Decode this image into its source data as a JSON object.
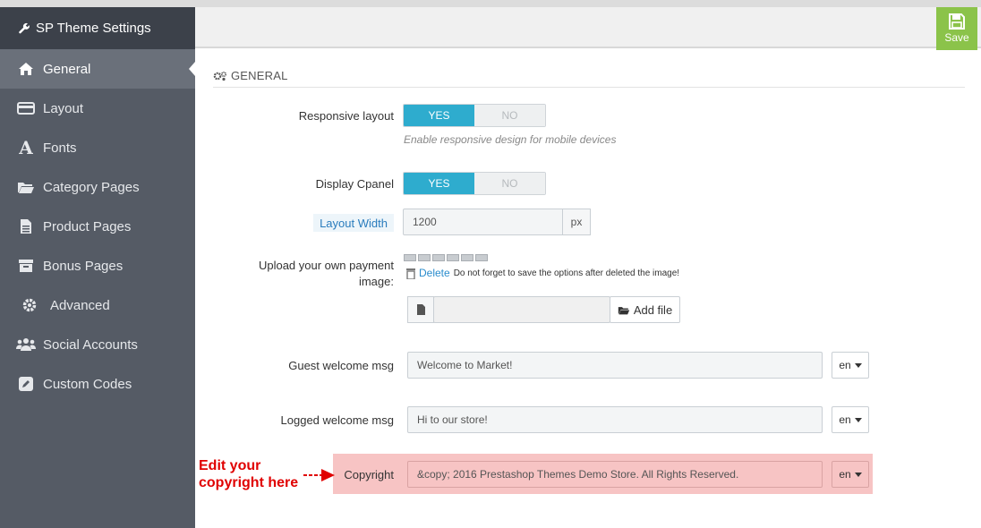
{
  "sidebar": {
    "title": "SP Theme Settings",
    "items": [
      {
        "label": "General",
        "icon": "home-icon",
        "active": true
      },
      {
        "label": "Layout",
        "icon": "credit-card-icon",
        "active": false
      },
      {
        "label": "Fonts",
        "icon": "font-icon",
        "active": false
      },
      {
        "label": "Category Pages",
        "icon": "folder-open-icon",
        "active": false
      },
      {
        "label": "Product Pages",
        "icon": "file-icon",
        "active": false
      },
      {
        "label": "Bonus Pages",
        "icon": "archive-icon",
        "active": false
      },
      {
        "label": "Advanced",
        "icon": "gear-icon",
        "active": false
      },
      {
        "label": "Social Accounts",
        "icon": "users-icon",
        "active": false
      },
      {
        "label": "Custom Codes",
        "icon": "pencil-icon",
        "active": false
      }
    ]
  },
  "toolbar": {
    "save_label": "Save"
  },
  "panel": {
    "title": "GENERAL"
  },
  "form": {
    "responsive": {
      "label": "Responsive layout",
      "yes": "YES",
      "no": "NO",
      "help": "Enable responsive design for mobile devices"
    },
    "cpanel": {
      "label": "Display Cpanel",
      "yes": "YES",
      "no": "NO"
    },
    "layout_width": {
      "label": "Layout Width",
      "value": "1200",
      "unit": "px"
    },
    "payment": {
      "label": "Upload your own payment image:",
      "delete_label": "Delete",
      "delete_note": "Do not forget to save the options after deleted the image!",
      "add_file_label": "Add file"
    },
    "guest": {
      "label": "Guest welcome msg",
      "value": "Welcome to Market!",
      "lang": "en"
    },
    "logged": {
      "label": "Logged welcome msg",
      "value": "Hi to our store!",
      "lang": "en"
    },
    "copyright": {
      "label": "Copyright",
      "value": "&copy; 2016 Prestashop Themes Demo Store. All Rights Reserved.",
      "lang": "en"
    }
  },
  "annotation": {
    "text_line1": "Edit your",
    "text_line2": "copyright here"
  },
  "colors": {
    "accent": "#2eacce",
    "save": "#8bc34a",
    "sidebar": "#555b65",
    "highlight": "#f7c4c4",
    "annotation": "#e00000"
  }
}
